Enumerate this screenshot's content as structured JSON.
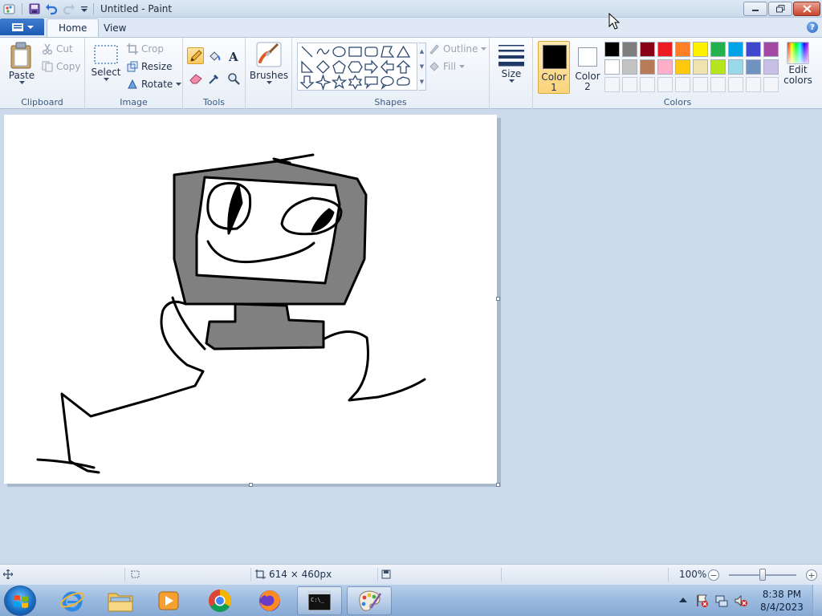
{
  "window": {
    "title": "Untitled - Paint"
  },
  "tabs": {
    "home": "Home",
    "view": "View"
  },
  "ribbon": {
    "clipboard": {
      "label": "Clipboard",
      "paste": "Paste",
      "cut": "Cut",
      "copy": "Copy"
    },
    "image": {
      "label": "Image",
      "select": "Select",
      "crop": "Crop",
      "resize": "Resize",
      "rotate": "Rotate"
    },
    "tools": {
      "label": "Tools"
    },
    "brushes": {
      "label": "Brushes"
    },
    "shapes": {
      "label": "Shapes",
      "outline": "Outline",
      "fill": "Fill"
    },
    "size": {
      "label": "Size"
    },
    "colors": {
      "label": "Colors",
      "color1_line1": "Color",
      "color1_line2": "1",
      "color2_line1": "Color",
      "color2_line2": "2",
      "edit_line1": "Edit",
      "edit_line2": "colors",
      "color1": "#000000",
      "color2": "#ffffff",
      "palette_row1": [
        "#000000",
        "#7f7f7f",
        "#880015",
        "#ed1c24",
        "#ff7f27",
        "#fff200",
        "#22b14c",
        "#00a2e8",
        "#3f48cc",
        "#a349a4"
      ],
      "palette_row2": [
        "#ffffff",
        "#c3c3c3",
        "#b97a57",
        "#ffaec9",
        "#ffc90e",
        "#efe4b0",
        "#b5e61d",
        "#99d9ea",
        "#7092be",
        "#c8bfe7"
      ]
    }
  },
  "statusbar": {
    "image_size": "614 × 460px",
    "zoom": "100%",
    "zoom_fraction": 0.5
  },
  "taskbar": {
    "time": "8:38 PM",
    "date": "8/4/2023"
  }
}
